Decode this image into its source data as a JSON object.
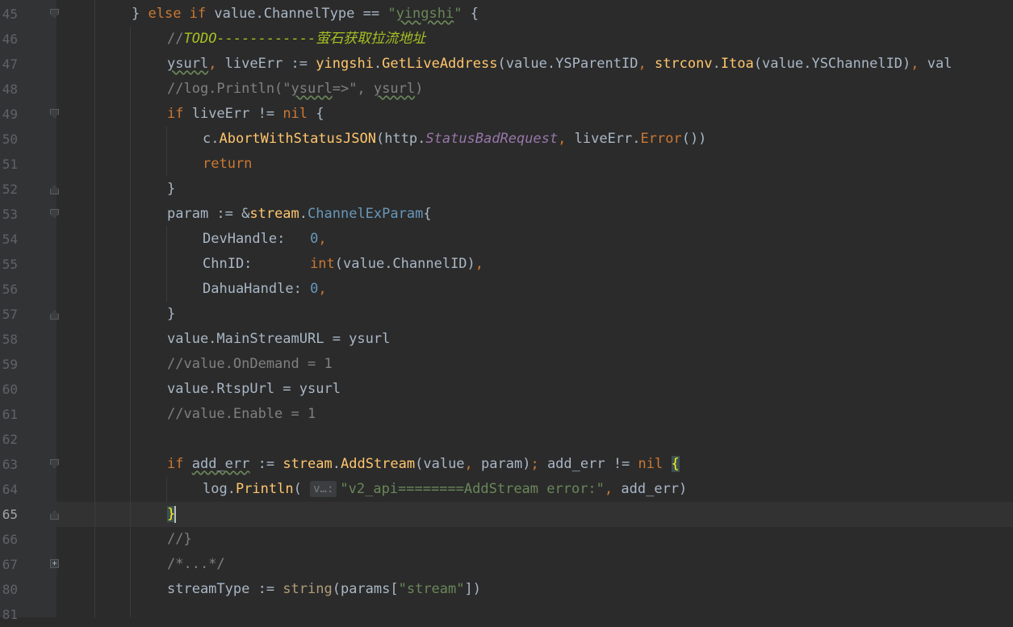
{
  "editor": {
    "current_line": "65",
    "lines": [
      {
        "n": "45",
        "fold": "open",
        "indent": 1,
        "segs": [
          {
            "t": "} ",
            "c": ""
          },
          {
            "t": "else if ",
            "c": "kw"
          },
          {
            "t": "value.ChannelType == ",
            "c": ""
          },
          {
            "t": "\"",
            "c": "str"
          },
          {
            "t": "yingshi",
            "c": "str wavy"
          },
          {
            "t": "\"",
            "c": "str"
          },
          {
            "t": " {",
            "c": ""
          }
        ]
      },
      {
        "n": "46",
        "fold": "",
        "indent": 2,
        "segs": [
          {
            "t": "//",
            "c": "cm"
          },
          {
            "t": "TODO------------萤石获取拉流地址",
            "c": "todo"
          }
        ]
      },
      {
        "n": "47",
        "fold": "",
        "indent": 2,
        "segs": [
          {
            "t": "ysurl",
            "c": "wavy"
          },
          {
            "t": ", ",
            "c": "kw"
          },
          {
            "t": "liveErr := ",
            "c": ""
          },
          {
            "t": "yingshi",
            "c": "fn"
          },
          {
            "t": ".",
            "c": ""
          },
          {
            "t": "GetLiveAddress",
            "c": "fn"
          },
          {
            "t": "(value.YSParentID",
            "c": ""
          },
          {
            "t": ", ",
            "c": "kw"
          },
          {
            "t": "strconv",
            "c": "fn"
          },
          {
            "t": ".",
            "c": ""
          },
          {
            "t": "Itoa",
            "c": "fn"
          },
          {
            "t": "(value.YSChannelID)",
            "c": ""
          },
          {
            "t": ", ",
            "c": "kw"
          },
          {
            "t": "val",
            "c": ""
          }
        ]
      },
      {
        "n": "48",
        "fold": "",
        "indent": 2,
        "segs": [
          {
            "t": "//log.Println(\"",
            "c": "cm"
          },
          {
            "t": "ysurl",
            "c": "cm wavy"
          },
          {
            "t": "=>\", ",
            "c": "cm"
          },
          {
            "t": "ysurl",
            "c": "cm wavy"
          },
          {
            "t": ")",
            "c": "cm"
          }
        ]
      },
      {
        "n": "49",
        "fold": "open",
        "indent": 2,
        "segs": [
          {
            "t": "if ",
            "c": "kw"
          },
          {
            "t": "liveErr != ",
            "c": ""
          },
          {
            "t": "nil",
            "c": "kw"
          },
          {
            "t": " {",
            "c": ""
          }
        ]
      },
      {
        "n": "50",
        "fold": "",
        "indent": 3,
        "segs": [
          {
            "t": "c.",
            "c": ""
          },
          {
            "t": "AbortWithStatusJSON",
            "c": "fn"
          },
          {
            "t": "(http.",
            "c": ""
          },
          {
            "t": "StatusBadRequest",
            "c": "const"
          },
          {
            "t": ", ",
            "c": "kw"
          },
          {
            "t": "liveErr.",
            "c": ""
          },
          {
            "t": "Error",
            "c": "meth"
          },
          {
            "t": "())",
            "c": ""
          }
        ]
      },
      {
        "n": "51",
        "fold": "",
        "indent": 3,
        "segs": [
          {
            "t": "return",
            "c": "kw"
          }
        ]
      },
      {
        "n": "52",
        "fold": "close",
        "indent": 2,
        "segs": [
          {
            "t": "}",
            "c": ""
          }
        ]
      },
      {
        "n": "53",
        "fold": "open",
        "indent": 2,
        "segs": [
          {
            "t": "param := &",
            "c": ""
          },
          {
            "t": "stream",
            "c": "fn"
          },
          {
            "t": ".",
            "c": ""
          },
          {
            "t": "ChannelExParam",
            "c": "typename"
          },
          {
            "t": "{",
            "c": ""
          }
        ]
      },
      {
        "n": "54",
        "fold": "",
        "indent": 3,
        "segs": [
          {
            "t": "DevHandle:   ",
            "c": ""
          },
          {
            "t": "0",
            "c": "num"
          },
          {
            "t": ",",
            "c": "kw"
          }
        ]
      },
      {
        "n": "55",
        "fold": "",
        "indent": 3,
        "segs": [
          {
            "t": "ChnID:       ",
            "c": ""
          },
          {
            "t": "int",
            "c": "type"
          },
          {
            "t": "(value.ChannelID)",
            "c": ""
          },
          {
            "t": ",",
            "c": "kw"
          }
        ]
      },
      {
        "n": "56",
        "fold": "",
        "indent": 3,
        "segs": [
          {
            "t": "DahuaHandle: ",
            "c": ""
          },
          {
            "t": "0",
            "c": "num"
          },
          {
            "t": ",",
            "c": "kw"
          }
        ]
      },
      {
        "n": "57",
        "fold": "close",
        "indent": 2,
        "segs": [
          {
            "t": "}",
            "c": ""
          }
        ]
      },
      {
        "n": "58",
        "fold": "",
        "indent": 2,
        "segs": [
          {
            "t": "value.MainStreamURL = ysurl",
            "c": ""
          }
        ]
      },
      {
        "n": "59",
        "fold": "",
        "indent": 2,
        "segs": [
          {
            "t": "//value.OnDemand = 1",
            "c": "cm"
          }
        ]
      },
      {
        "n": "60",
        "fold": "",
        "indent": 2,
        "segs": [
          {
            "t": "value.RtspUrl = ysurl",
            "c": ""
          }
        ]
      },
      {
        "n": "61",
        "fold": "",
        "indent": 2,
        "segs": [
          {
            "t": "//value.Enable = 1",
            "c": "cm"
          }
        ]
      },
      {
        "n": "62",
        "fold": "",
        "indent": 2,
        "segs": []
      },
      {
        "n": "63",
        "fold": "open",
        "indent": 2,
        "segs": [
          {
            "t": "if ",
            "c": "kw"
          },
          {
            "t": "add_err",
            "c": "wavy"
          },
          {
            "t": " := ",
            "c": ""
          },
          {
            "t": "stream",
            "c": "fn"
          },
          {
            "t": ".",
            "c": ""
          },
          {
            "t": "AddStream",
            "c": "fn"
          },
          {
            "t": "(value",
            "c": ""
          },
          {
            "t": ", ",
            "c": "kw"
          },
          {
            "t": "param)",
            "c": ""
          },
          {
            "t": "; ",
            "c": "kw"
          },
          {
            "t": "add_err != ",
            "c": ""
          },
          {
            "t": "nil",
            "c": "kw"
          },
          {
            "t": " ",
            "c": ""
          },
          {
            "t": "{",
            "c": "brace-hl"
          }
        ]
      },
      {
        "n": "64",
        "fold": "",
        "indent": 3,
        "segs": [
          {
            "t": "log.",
            "c": ""
          },
          {
            "t": "Println",
            "c": "fn"
          },
          {
            "t": "( ",
            "c": ""
          },
          {
            "t": "v…:",
            "c": "hint"
          },
          {
            "t": "\"v2_api========AddStream error:\"",
            "c": "str"
          },
          {
            "t": ", ",
            "c": "kw"
          },
          {
            "t": "add_err)",
            "c": ""
          }
        ]
      },
      {
        "n": "65",
        "fold": "close",
        "indent": 2,
        "segs": [
          {
            "t": "}",
            "c": "brace-hl"
          },
          {
            "t": "",
            "c": "caret"
          }
        ]
      },
      {
        "n": "66",
        "fold": "",
        "indent": 2,
        "segs": [
          {
            "t": "//}",
            "c": "cm"
          }
        ]
      },
      {
        "n": "67",
        "fold": "plus",
        "indent": 2,
        "segs": [
          {
            "t": "/*...*/",
            "c": "cm"
          }
        ]
      },
      {
        "n": "80",
        "fold": "",
        "indent": 2,
        "segs": [
          {
            "t": "streamType := ",
            "c": ""
          },
          {
            "t": "string",
            "c": "fn2"
          },
          {
            "t": "(params[",
            "c": ""
          },
          {
            "t": "\"stream\"",
            "c": "str"
          },
          {
            "t": "])",
            "c": ""
          }
        ]
      },
      {
        "n": "81",
        "fold": "",
        "indent": 2,
        "segs": []
      }
    ]
  }
}
